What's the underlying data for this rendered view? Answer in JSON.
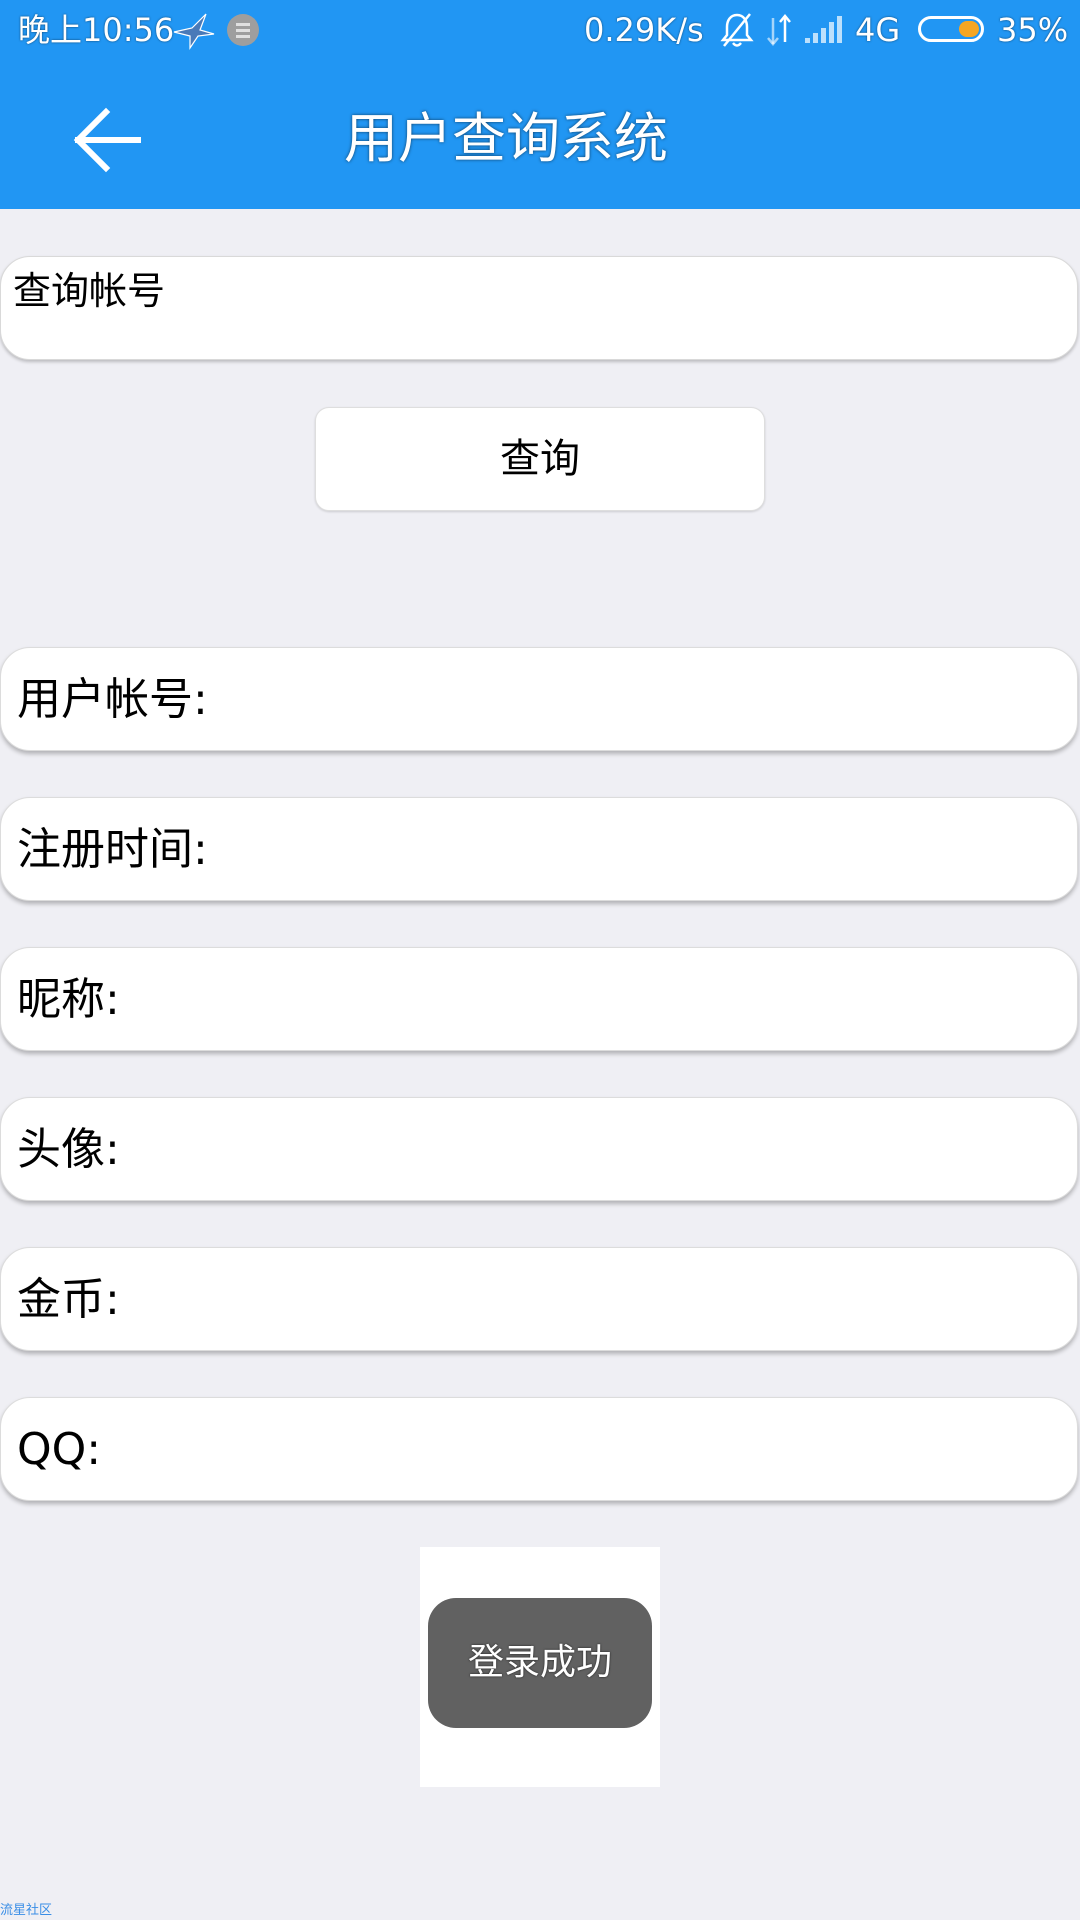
{
  "status_bar": {
    "time": "晚上10:56",
    "net_speed": "0.29K/s",
    "network_type": "4G",
    "battery_percent": "35%",
    "battery_level": 0.35,
    "icons": [
      "bird-app-icon",
      "notification-dot-icon",
      "bell-muted-icon",
      "data-arrows-icon",
      "signal-icon",
      "battery-icon"
    ]
  },
  "app_bar": {
    "title": "用户查询系统",
    "back_icon": "arrow-left-icon"
  },
  "search": {
    "placeholder": "查询帐号",
    "value": ""
  },
  "query_button": {
    "label": "查询"
  },
  "fields": [
    {
      "label": "用户帐号:"
    },
    {
      "label": "注册时间:"
    },
    {
      "label": "昵称:"
    },
    {
      "label": "头像:"
    },
    {
      "label": "金币:"
    },
    {
      "label": "QQ:"
    }
  ],
  "toast": {
    "message": "登录成功"
  },
  "watermark": {
    "text": "流星社区"
  },
  "colors": {
    "primary": "#2196f3",
    "background": "#efeff4",
    "toast": "#616161",
    "battery_accent": "#f5a623"
  }
}
